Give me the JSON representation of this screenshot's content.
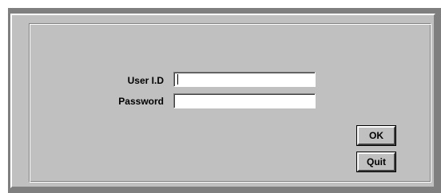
{
  "login_form": {
    "user_id_label": "User I.D",
    "user_id_value": "",
    "password_label": "Password",
    "password_value": "",
    "ok_label": "OK",
    "quit_label": "Quit"
  }
}
